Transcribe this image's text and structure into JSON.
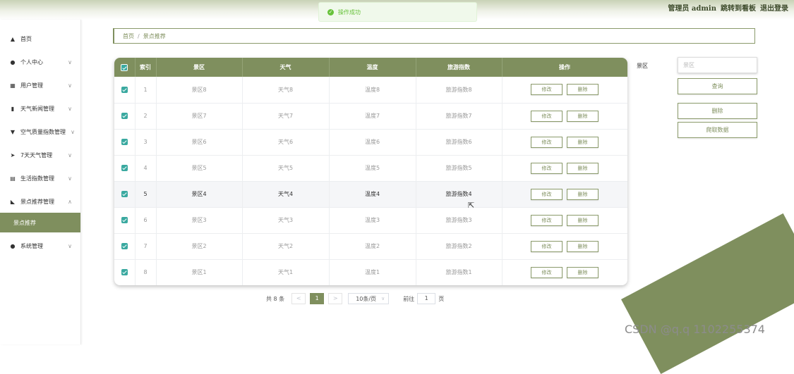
{
  "header": {
    "admin_label": "管理员 admin",
    "jump_link": "跳转到看板",
    "logout_link": "退出登录"
  },
  "toast": {
    "message": "操作成功"
  },
  "sidebar": {
    "items": [
      {
        "label": "首页",
        "icon": "home-icon",
        "arrow": ""
      },
      {
        "label": "个人中心",
        "icon": "user-icon",
        "arrow": "∨"
      },
      {
        "label": "用户管理",
        "icon": "grid-icon",
        "arrow": "∨"
      },
      {
        "label": "天气新闻管理",
        "icon": "chart-icon",
        "arrow": "∨"
      },
      {
        "label": "空气质量指数管理",
        "icon": "filter-icon",
        "arrow": "∨"
      },
      {
        "label": "7天天气管理",
        "icon": "send-icon",
        "arrow": "∨"
      },
      {
        "label": "生活指数管理",
        "icon": "clipboard-icon",
        "arrow": "∨"
      },
      {
        "label": "景点推荐管理",
        "icon": "thumb-icon",
        "arrow": "∧"
      },
      {
        "label": "系统管理",
        "icon": "user-icon",
        "arrow": "∨"
      }
    ],
    "submenu_active": "景点推荐"
  },
  "breadcrumb": {
    "home": "首页",
    "separator": "/",
    "current": "景点推荐"
  },
  "table": {
    "headers": [
      "索引",
      "景区",
      "天气",
      "温度",
      "旅游指数",
      "操作"
    ],
    "rows": [
      {
        "index": "1",
        "scenic": "景区8",
        "weather": "天气8",
        "temp": "温度8",
        "tour": "旅游指数8"
      },
      {
        "index": "2",
        "scenic": "景区7",
        "weather": "天气7",
        "temp": "温度7",
        "tour": "旅游指数7"
      },
      {
        "index": "3",
        "scenic": "景区6",
        "weather": "天气6",
        "temp": "温度6",
        "tour": "旅游指数6"
      },
      {
        "index": "4",
        "scenic": "景区5",
        "weather": "天气5",
        "temp": "温度5",
        "tour": "旅游指数5"
      },
      {
        "index": "5",
        "scenic": "景区4",
        "weather": "天气4",
        "temp": "温度4",
        "tour": "旅游指数4"
      },
      {
        "index": "6",
        "scenic": "景区3",
        "weather": "天气3",
        "temp": "温度3",
        "tour": "旅游指数3"
      },
      {
        "index": "7",
        "scenic": "景区2",
        "weather": "天气2",
        "temp": "温度2",
        "tour": "旅游指数2"
      },
      {
        "index": "8",
        "scenic": "景区1",
        "weather": "天气1",
        "temp": "温度1",
        "tour": "旅游指数1"
      }
    ],
    "edit_label": "修改",
    "delete_label": "删除"
  },
  "search": {
    "label": "景区",
    "placeholder": "景区",
    "query_button": "查询",
    "delete_button": "删除",
    "crawl_button": "爬取数据"
  },
  "pagination": {
    "total": "共 8 条",
    "prev": "<",
    "current_page": "1",
    "next": ">",
    "page_size": "10条/页",
    "goto_label": "前往",
    "goto_value": "1",
    "page_unit": "页"
  },
  "watermark": "CSDN @q.q 1102255374",
  "colors": {
    "accent": "#7f8f5e",
    "checkbox": "#3aa9a0",
    "success": "#67c23a"
  }
}
